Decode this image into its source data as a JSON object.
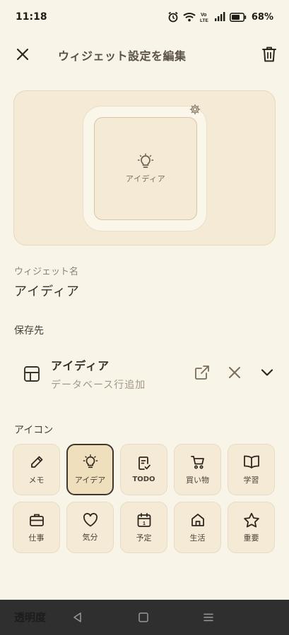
{
  "status": {
    "time": "11:18",
    "battery": "68%"
  },
  "header": {
    "title": "ウィジェット設定を編集"
  },
  "preview": {
    "widget_label": "アイディア"
  },
  "name_field": {
    "label": "ウィジェット名",
    "value": "アイディア"
  },
  "destination": {
    "label": "保存先",
    "name": "アイディア",
    "action": "データベース行追加"
  },
  "icons": {
    "label": "アイコン",
    "items": [
      {
        "label": "メモ",
        "icon": "pencil-icon"
      },
      {
        "label": "アイデア",
        "icon": "lightbulb-icon",
        "selected": true
      },
      {
        "label": "TODO",
        "icon": "todo-icon"
      },
      {
        "label": "買い物",
        "icon": "cart-icon"
      },
      {
        "label": "学習",
        "icon": "book-icon"
      },
      {
        "label": "仕事",
        "icon": "briefcase-icon"
      },
      {
        "label": "気分",
        "icon": "heart-icon"
      },
      {
        "label": "予定",
        "icon": "calendar-icon"
      },
      {
        "label": "生活",
        "icon": "home-icon"
      },
      {
        "label": "重要",
        "icon": "star-icon"
      }
    ]
  },
  "bottom": {
    "title": "透明度"
  },
  "colors": {
    "background": "#f9f4e8",
    "card": "#f4ead6",
    "accent_dark": "#3f372c",
    "muted": "#8e8373",
    "nav_bar": "#2f2f2f"
  }
}
